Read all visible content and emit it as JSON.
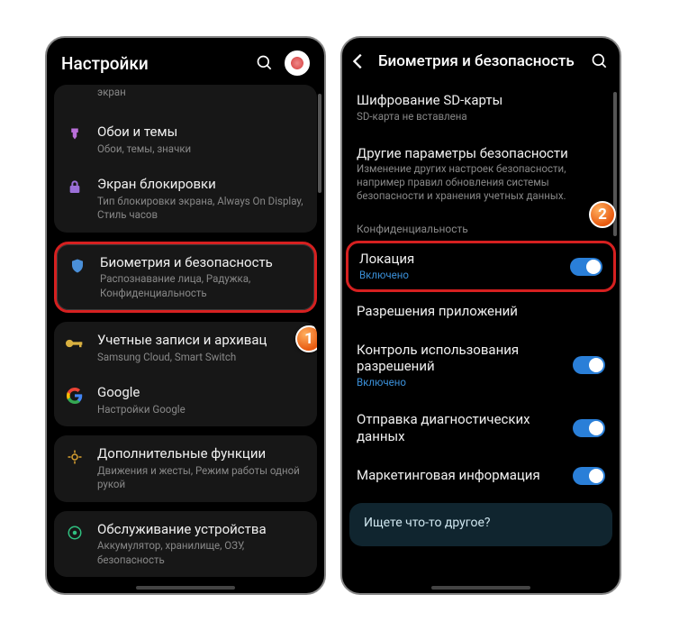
{
  "left": {
    "title": "Настройки",
    "items": [
      {
        "icon": "screen",
        "title": "",
        "sub": "экран",
        "partial": true
      },
      {
        "icon": "brush",
        "title": "Обои и темы",
        "sub": "Обои, темы, значки"
      },
      {
        "icon": "lock",
        "title": "Экран блокировки",
        "sub": "Тип блокировки экрана, Always On Display, Стиль часов"
      },
      {
        "icon": "shield",
        "title": "Биометрия и безопасность",
        "sub": "Распознавание лица, Радужка, Конфиденциальность",
        "highlight": true
      },
      {
        "icon": "key",
        "title": "Учетные записи и архивац",
        "sub": "Samsung Cloud, Smart Switch"
      },
      {
        "icon": "google",
        "title": "Google",
        "sub": "Настройки Google"
      },
      {
        "icon": "dots",
        "title": "Дополнительные функции",
        "sub": "Движения и жесты, Режим работы одной рукой"
      },
      {
        "icon": "care",
        "title": "Обслуживание устройства",
        "sub": "Аккумулятор, хранилище, ОЗУ, безопасность"
      }
    ],
    "badge": "1"
  },
  "right": {
    "title": "Биометрия и безопасность",
    "top": [
      {
        "title": "Шифрование SD-карты",
        "sub": "SD-карта не вставлена"
      },
      {
        "title": "Другие параметры безопасности",
        "sub": "Изменение других настроек безопасности, например правил обновления системы безопасности и хранения учетных данных."
      }
    ],
    "section": "Конфиденциальность",
    "privacy": [
      {
        "title": "Локация",
        "sub": "Включено",
        "subblue": true,
        "toggle": true,
        "highlight": true
      },
      {
        "title": "Разрешения приложений"
      },
      {
        "title": "Контроль использования разрешений",
        "sub": "Включено",
        "subblue": true,
        "toggle": true
      },
      {
        "title": "Отправка диагностических данных",
        "toggle": true
      },
      {
        "title": "Маркетинговая информация",
        "toggle": true
      }
    ],
    "footer": "Ищете что-то другое?",
    "badge": "2"
  }
}
